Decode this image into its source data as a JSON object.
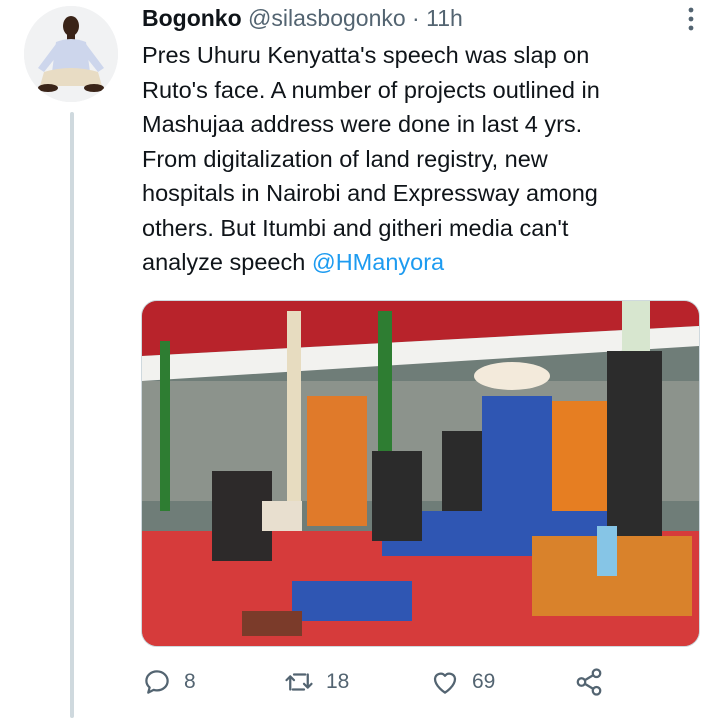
{
  "tweet": {
    "display_name": "Bogonko",
    "handle": "@silasbogonko",
    "separator": "·",
    "time": "11h",
    "text_lines": [
      "Pres Uhuru Kenyatta's speech was slap on",
      "Ruto's face. A number of projects outlined in",
      "Mashujaa address were done in last 4 yrs.",
      "From digitalization of land registry, new",
      "hospitals in Nairobi and Expressway among",
      "others. But Itumbi and githeri media can't"
    ],
    "last_line_text": "analyze speech ",
    "mention": "@HManyora"
  },
  "actions": {
    "replies": "8",
    "retweets": "18",
    "likes": "69"
  },
  "icons": {
    "more": "more-vertical-icon",
    "reply": "reply-icon",
    "retweet": "retweet-icon",
    "like": "heart-icon",
    "share": "share-icon"
  },
  "colors": {
    "text": "#0f1419",
    "secondary": "#536471",
    "link": "#1d9bf0",
    "thread_line": "#cfd9de"
  }
}
